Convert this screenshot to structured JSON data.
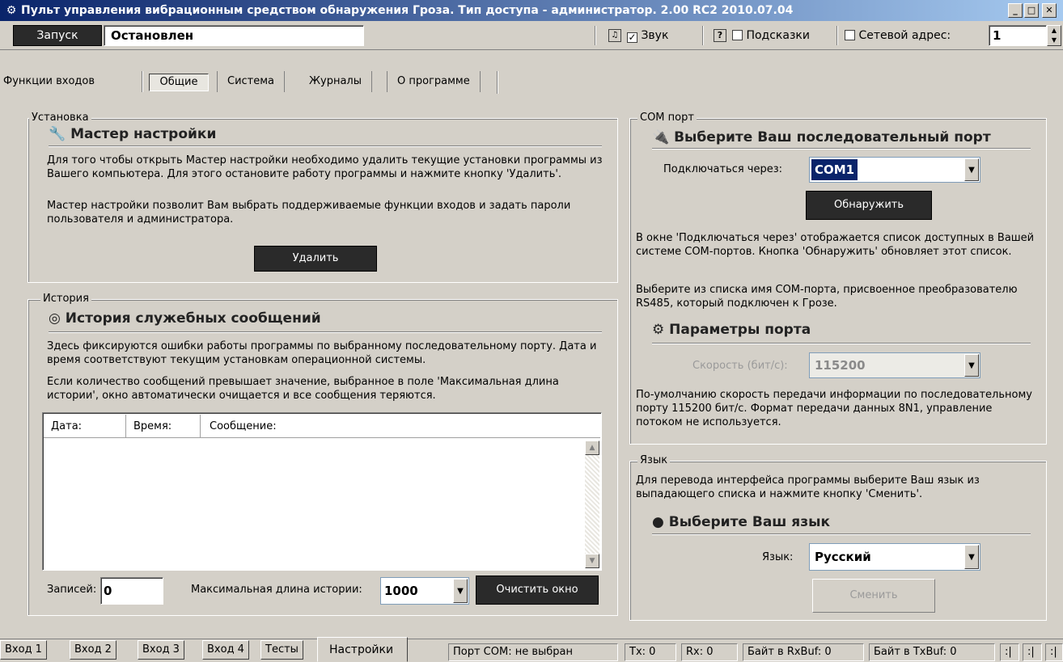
{
  "window": {
    "title": "Пульт управления вибрационным средством обнаружения Гроза. Тип доступа - администратор. 2.00 RC2 2010.07.04"
  },
  "toolbar": {
    "start_label": "Запуск",
    "status_value": "Остановлен",
    "sound_label": "Звук",
    "hints_label": "Подсказки",
    "net_address_label": "Сетевой адрес:",
    "net_address_value": "1"
  },
  "tabs": [
    "Функции входов",
    "Общие",
    "Система",
    "Журналы",
    "О программе"
  ],
  "install": {
    "group_label": "Установка",
    "heading": "Мастер настройки",
    "text1": "Для того чтобы открыть Мастер настройки необходимо удалить текущие установки программы из Вашего компьютера. Для этого остановите работу программы и нажмите кнопку 'Удалить'.",
    "text2": "Мастер настройки позволит Вам выбрать поддерживаемые функции входов и задать пароли пользователя и администратора.",
    "delete_label": "Удалить"
  },
  "history": {
    "group_label": "История",
    "heading": "История служебных сообщений",
    "text1": "Здесь фиксируются ошибки работы программы по выбранному последовательному порту. Дата и время соответствуют текущим установкам операционной системы.",
    "text2": "Если количество сообщений превышает значение, выбранное в поле 'Максимальная длина истории', окно автоматически очищается и все сообщения теряются.",
    "columns": [
      "Дата:",
      "Время:",
      "Сообщение:"
    ],
    "records_label": "Записей:",
    "records_value": "0",
    "max_len_label": "Максимальная длина истории:",
    "max_len_value": "1000",
    "clear_label": "Очистить окно"
  },
  "com": {
    "group_label": "COM порт",
    "heading": "Выберите Ваш последовательный порт",
    "connect_label": "Подключаться через:",
    "connect_value": "COM1",
    "detect_label": "Обнаружить",
    "text1": "В окне 'Подключаться через' отображается список доступных в Вашей системе COM-портов. Кнопка 'Обнаружить' обновляет этот список.",
    "text2": "Выберите из списка имя COM-порта, присвоенное преобразователю RS485, который подключен к Грозе.",
    "params_heading": "Параметры порта",
    "speed_label": "Скорость (бит/с):",
    "speed_value": "115200",
    "text3": "По-умолчанию скорость передачи информации по последовательному порту 115200 бит/с. Формат передачи данных 8N1, управление потоком не используется."
  },
  "lang": {
    "group_label": "Язык",
    "text": "Для перевода интерфейса программы выберите Ваш язык из выпадающего списка и нажмите кнопку 'Сменить'.",
    "heading": "Выберите Ваш язык",
    "lang_label": "Язык:",
    "lang_value": "Русский",
    "change_label": "Сменить"
  },
  "bottom_tabs": [
    "Вход 1",
    "Вход 2",
    "Вход 3",
    "Вход 4",
    "Тесты",
    "Настройки"
  ],
  "statusbar": {
    "port": "Порт COM: не выбран",
    "tx": "Tx: 0",
    "rx": "Rx: 0",
    "rxbuf": "Байт в RxBuf: 0",
    "txbuf": "Байт в TxBuf: 0",
    "ind1": ":|",
    "ind2": ":|",
    "ind3": ":|"
  }
}
